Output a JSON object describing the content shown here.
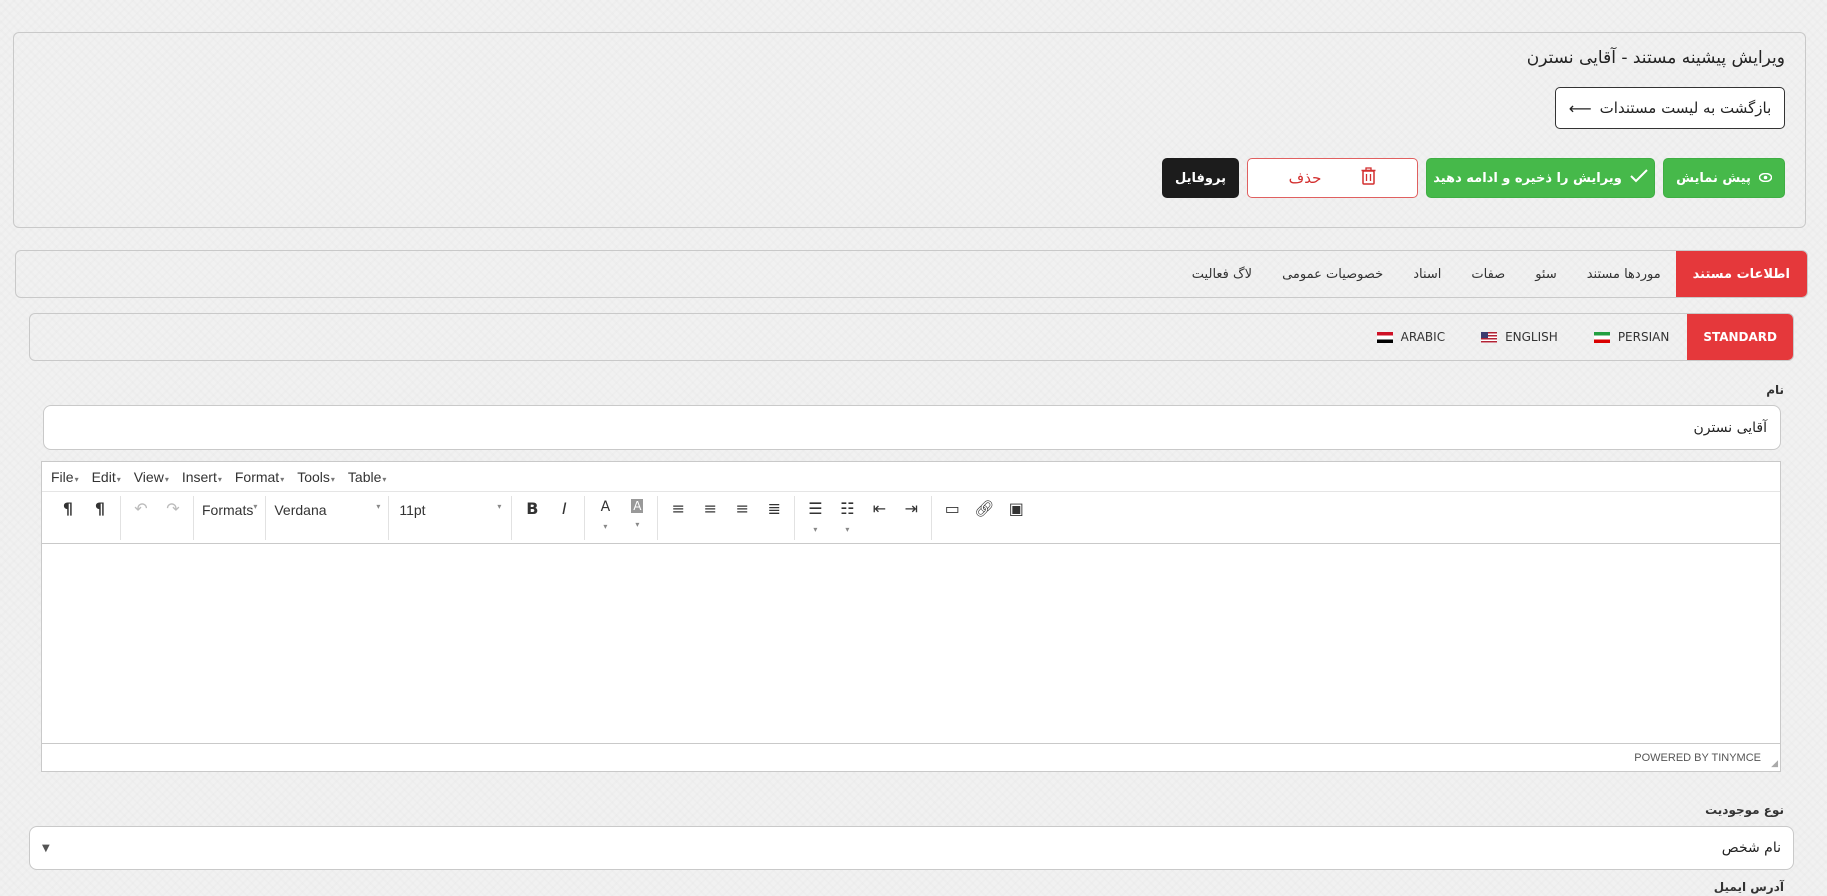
{
  "header": {
    "title": "ویرایش پیشینه مستند - آقایی نسترن",
    "back_label": "بازگشت به لیست مستندات",
    "buttons": {
      "preview": "پیش نمایش",
      "save": "ویرایش را ذخیره و ادامه دهید",
      "delete": "حذف",
      "profile": "پروفایل"
    }
  },
  "main_tabs": [
    {
      "label": "اطلاعات مستند",
      "active": true
    },
    {
      "label": "موردها مستند"
    },
    {
      "label": "سئو"
    },
    {
      "label": "صفات"
    },
    {
      "label": "اسناد"
    },
    {
      "label": "خصوصیات عمومی"
    },
    {
      "label": "لاگ فعالیت"
    }
  ],
  "lang_tabs": [
    {
      "label": "STANDARD",
      "active": true
    },
    {
      "label": "PERSIAN",
      "flag": "iran-flag"
    },
    {
      "label": "ENGLISH",
      "flag": "usa-flag"
    },
    {
      "label": "ARABIC",
      "flag": "egypt-flag"
    }
  ],
  "form": {
    "name_label": "نام",
    "name_value": "آقایی نسترن",
    "entity_type_label": "نوع موجودیت",
    "entity_type_value": "نام شخص",
    "email_label": "آدرس ایمیل"
  },
  "editor": {
    "menu": [
      "File",
      "Edit",
      "View",
      "Insert",
      "Format",
      "Tools",
      "Table"
    ],
    "formats_label": "Formats",
    "font_family": "Verdana",
    "font_size": "11pt",
    "powered_by": "POWERED BY TINYMCE"
  },
  "colors": {
    "accent_red": "#e5383b",
    "green": "#46b94a",
    "dark": "#1c1c1c"
  }
}
